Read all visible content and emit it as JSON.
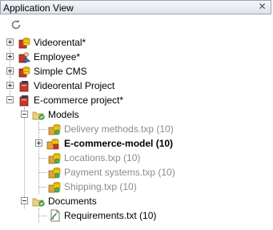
{
  "panel": {
    "title": "Application View"
  },
  "toolbar": {
    "refresh_icon": "refresh-icon"
  },
  "tree": {
    "items": [
      {
        "label": "Videorental*",
        "icon": "database-project-icon"
      },
      {
        "label": "Employee*",
        "icon": "user-project-icon"
      },
      {
        "label": "Simple CMS",
        "icon": "database-project-icon"
      },
      {
        "label": "Videorental Project",
        "icon": "project-icon"
      },
      {
        "label": "E-commerce project*",
        "icon": "project-icon"
      },
      {
        "label": "Models",
        "icon": "folder-icon"
      },
      {
        "label": "Delivery methods.txp (10)",
        "icon": "model-icon"
      },
      {
        "label": "E-commerce-model  (10)",
        "icon": "model-icon"
      },
      {
        "label": "Locations.txp (10)",
        "icon": "model-icon"
      },
      {
        "label": "Payment systems.txp (10)",
        "icon": "model-icon"
      },
      {
        "label": "Shipping.txp (10)",
        "icon": "model-icon"
      },
      {
        "label": "Documents",
        "icon": "folder-icon"
      },
      {
        "label": "Requirements.txt (10)",
        "icon": "document-icon"
      }
    ]
  }
}
